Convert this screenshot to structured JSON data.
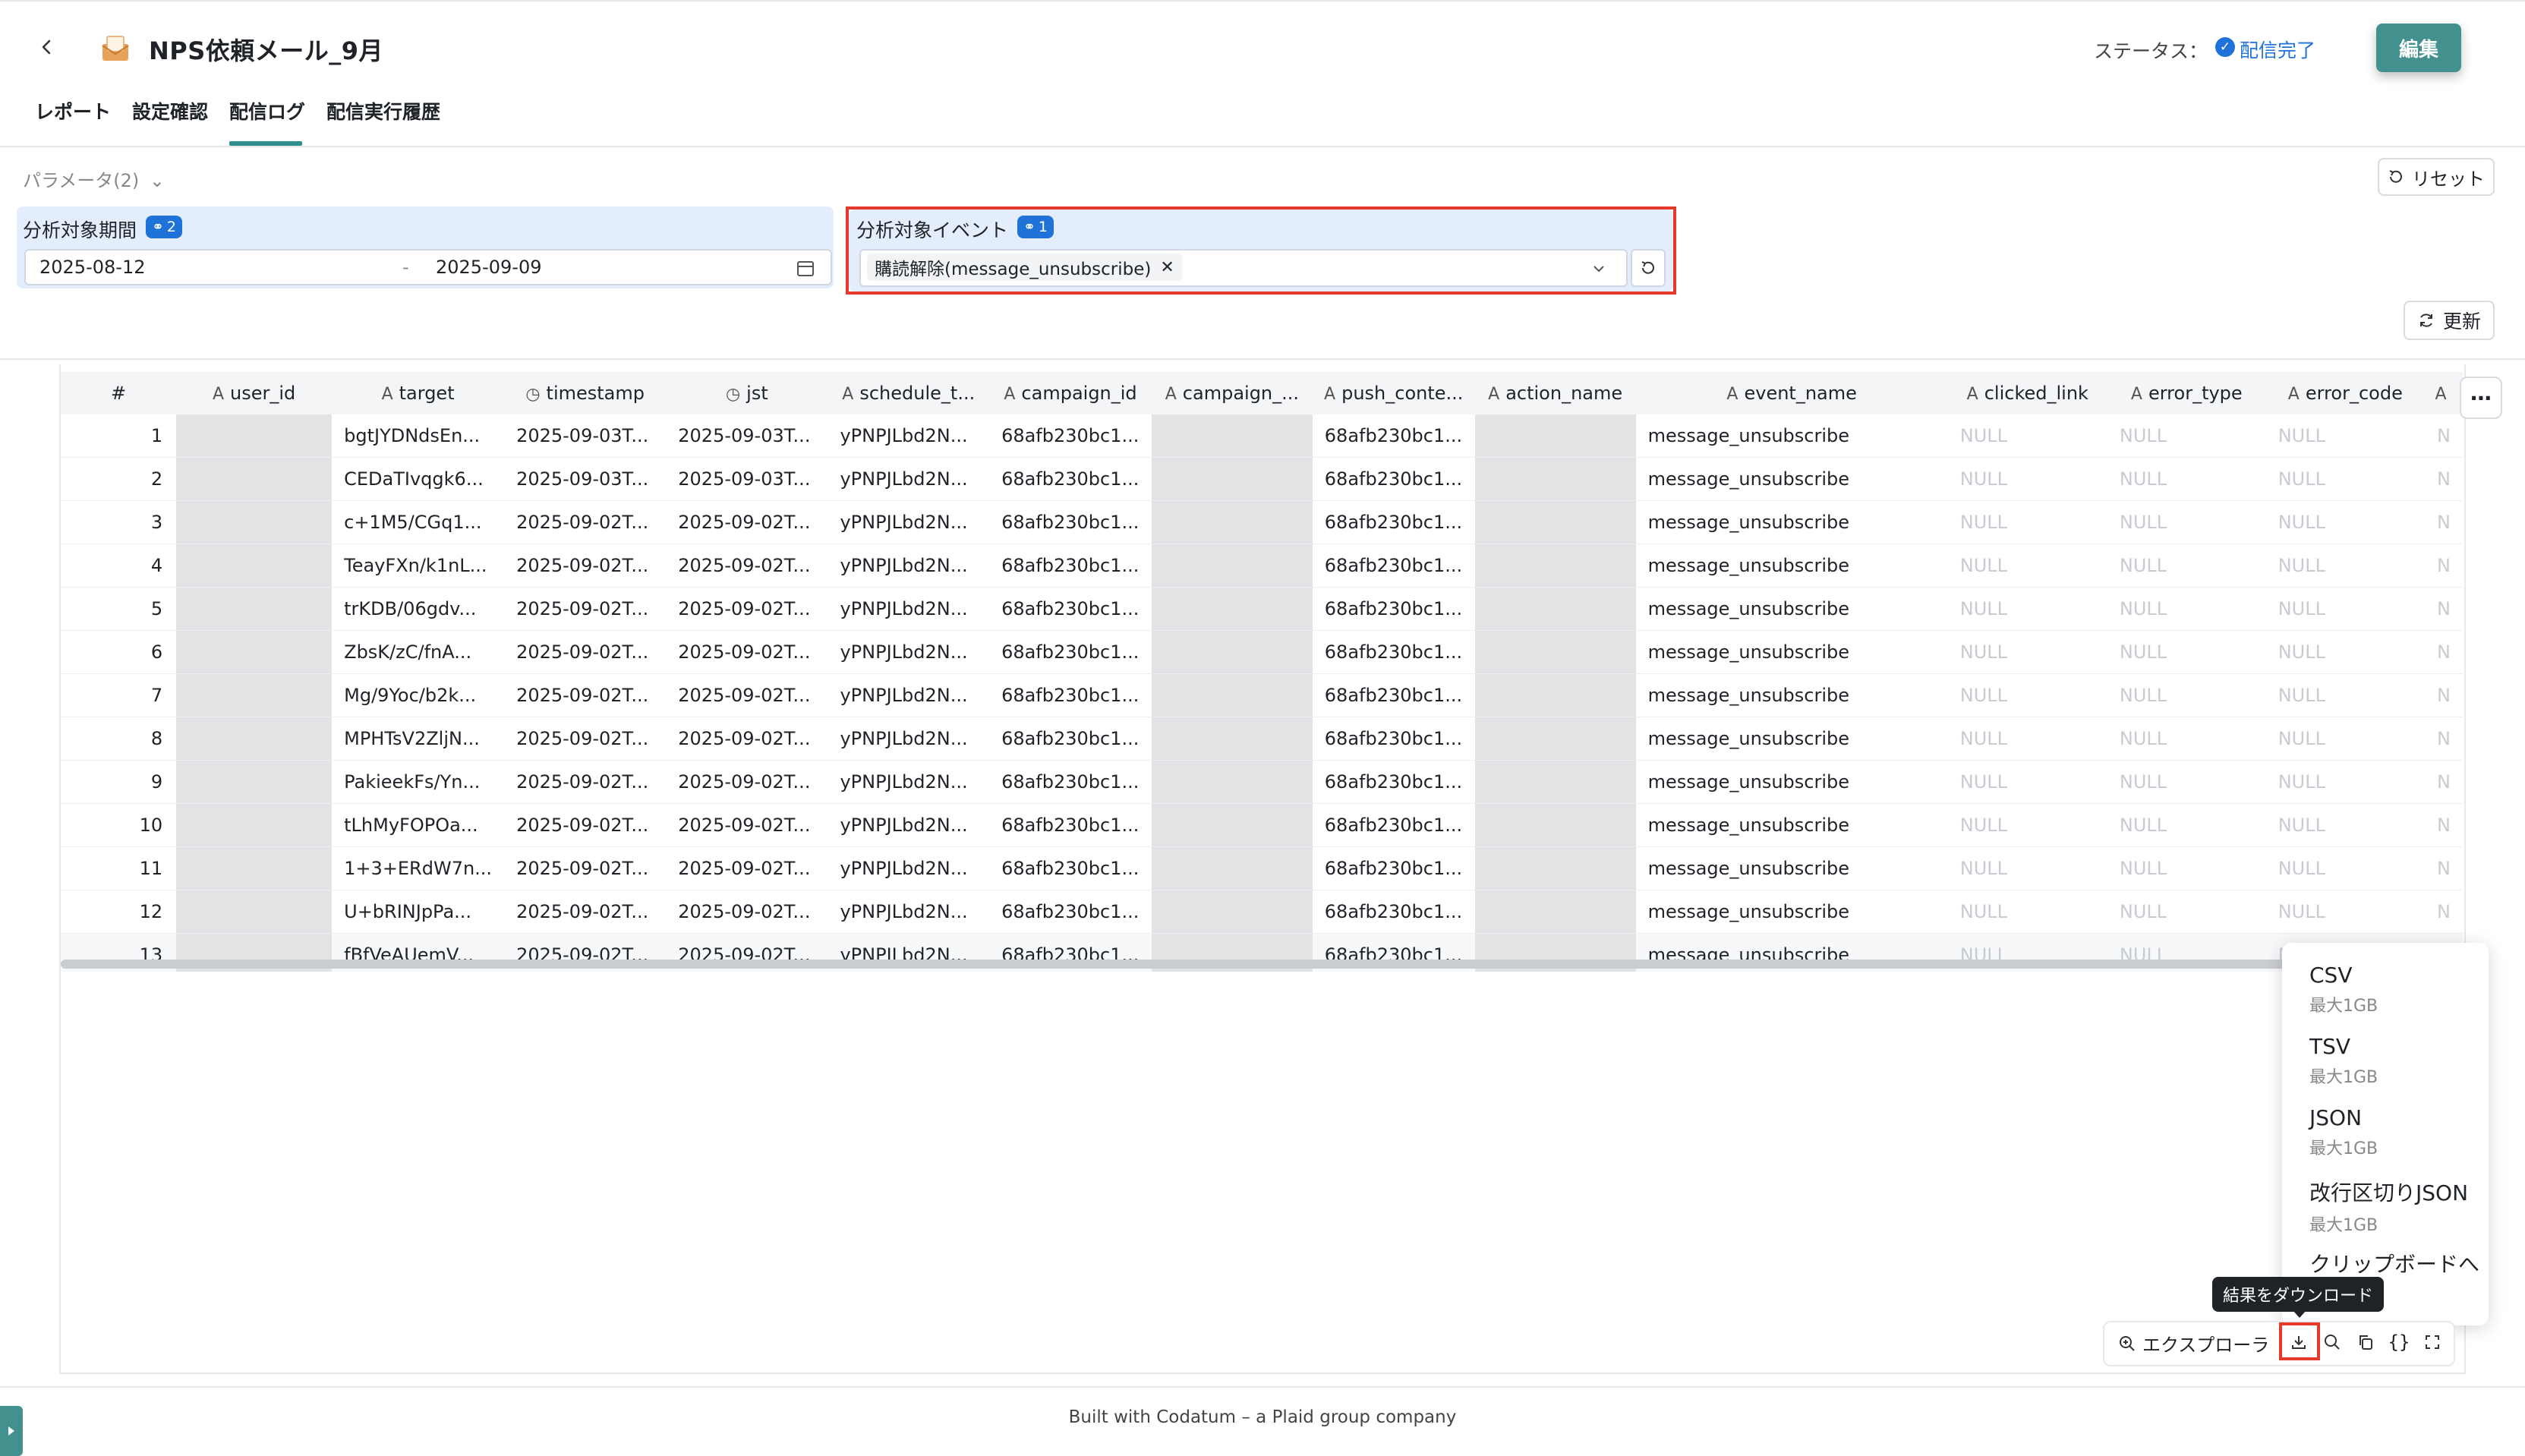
{
  "header": {
    "title": "NPS依頼メール_9月",
    "status_label": "ステータス：",
    "status_value": "配信完了",
    "edit_label": "編集"
  },
  "tabs": [
    {
      "label": "レポート"
    },
    {
      "label": "設定確認"
    },
    {
      "label": "配信ログ",
      "active": true
    },
    {
      "label": "配信実行履歴"
    }
  ],
  "params": {
    "toggle_label": "パラメータ(2)",
    "reset_label": "リセット",
    "refresh_label": "更新",
    "period": {
      "label": "分析対象期間",
      "badge": "2",
      "start": "2025-08-12",
      "separator": "-",
      "end": "2025-09-09"
    },
    "event": {
      "label": "分析対象イベント",
      "badge": "1",
      "chip": "購読解除(message_unsubscribe)"
    }
  },
  "table": {
    "columns": [
      {
        "label": "#",
        "icon": ""
      },
      {
        "label": "user_id",
        "icon": "A"
      },
      {
        "label": "target",
        "icon": "A"
      },
      {
        "label": "timestamp",
        "icon": "clock"
      },
      {
        "label": "jst",
        "icon": "clock"
      },
      {
        "label": "schedule_t...",
        "icon": "A"
      },
      {
        "label": "campaign_id",
        "icon": "A"
      },
      {
        "label": "campaign_...",
        "icon": "A"
      },
      {
        "label": "push_conte...",
        "icon": "A"
      },
      {
        "label": "action_name",
        "icon": "A"
      },
      {
        "label": "event_name",
        "icon": "A"
      },
      {
        "label": "clicked_link",
        "icon": "A"
      },
      {
        "label": "error_type",
        "icon": "A"
      },
      {
        "label": "error_code",
        "icon": "A"
      },
      {
        "label": "",
        "icon": "A"
      }
    ],
    "rows": [
      [
        "1",
        "",
        "bgtJYDNdsEn...",
        "2025-09-03T...",
        "2025-09-03T...",
        "yPNPJLbd2N...",
        "68afb230bc1...",
        "",
        "68afb230bc1...",
        "",
        "message_unsubscribe",
        "NULL",
        "NULL",
        "NULL",
        "N"
      ],
      [
        "2",
        "",
        "CEDaTIvqgk6...",
        "2025-09-03T...",
        "2025-09-03T...",
        "yPNPJLbd2N...",
        "68afb230bc1...",
        "",
        "68afb230bc1...",
        "",
        "message_unsubscribe",
        "NULL",
        "NULL",
        "NULL",
        "N"
      ],
      [
        "3",
        "",
        "c+1M5/CGq1...",
        "2025-09-02T...",
        "2025-09-02T...",
        "yPNPJLbd2N...",
        "68afb230bc1...",
        "",
        "68afb230bc1...",
        "",
        "message_unsubscribe",
        "NULL",
        "NULL",
        "NULL",
        "N"
      ],
      [
        "4",
        "",
        "TeayFXn/k1nL...",
        "2025-09-02T...",
        "2025-09-02T...",
        "yPNPJLbd2N...",
        "68afb230bc1...",
        "",
        "68afb230bc1...",
        "",
        "message_unsubscribe",
        "NULL",
        "NULL",
        "NULL",
        "N"
      ],
      [
        "5",
        "",
        "trKDB/06gdv...",
        "2025-09-02T...",
        "2025-09-02T...",
        "yPNPJLbd2N...",
        "68afb230bc1...",
        "",
        "68afb230bc1...",
        "",
        "message_unsubscribe",
        "NULL",
        "NULL",
        "NULL",
        "N"
      ],
      [
        "6",
        "",
        "ZbsK/zC/fnA...",
        "2025-09-02T...",
        "2025-09-02T...",
        "yPNPJLbd2N...",
        "68afb230bc1...",
        "",
        "68afb230bc1...",
        "",
        "message_unsubscribe",
        "NULL",
        "NULL",
        "NULL",
        "N"
      ],
      [
        "7",
        "",
        "Mg/9Yoc/b2k...",
        "2025-09-02T...",
        "2025-09-02T...",
        "yPNPJLbd2N...",
        "68afb230bc1...",
        "",
        "68afb230bc1...",
        "",
        "message_unsubscribe",
        "NULL",
        "NULL",
        "NULL",
        "N"
      ],
      [
        "8",
        "",
        "MPHTsV2ZljN...",
        "2025-09-02T...",
        "2025-09-02T...",
        "yPNPJLbd2N...",
        "68afb230bc1...",
        "",
        "68afb230bc1...",
        "",
        "message_unsubscribe",
        "NULL",
        "NULL",
        "NULL",
        "N"
      ],
      [
        "9",
        "",
        "PakieekFs/Yn...",
        "2025-09-02T...",
        "2025-09-02T...",
        "yPNPJLbd2N...",
        "68afb230bc1...",
        "",
        "68afb230bc1...",
        "",
        "message_unsubscribe",
        "NULL",
        "NULL",
        "NULL",
        "N"
      ],
      [
        "10",
        "",
        "tLhMyFOPOa...",
        "2025-09-02T...",
        "2025-09-02T...",
        "yPNPJLbd2N...",
        "68afb230bc1...",
        "",
        "68afb230bc1...",
        "",
        "message_unsubscribe",
        "NULL",
        "NULL",
        "NULL",
        "N"
      ],
      [
        "11",
        "",
        "1+3+ERdW7n...",
        "2025-09-02T...",
        "2025-09-02T...",
        "yPNPJLbd2N...",
        "68afb230bc1...",
        "",
        "68afb230bc1...",
        "",
        "message_unsubscribe",
        "NULL",
        "NULL",
        "NULL",
        "N"
      ],
      [
        "12",
        "",
        "U+bRINJpPa...",
        "2025-09-02T...",
        "2025-09-02T...",
        "yPNPJLbd2N...",
        "68afb230bc1...",
        "",
        "68afb230bc1...",
        "",
        "message_unsubscribe",
        "NULL",
        "NULL",
        "NULL",
        "N"
      ],
      [
        "13",
        "",
        "fBfVeAUemV...",
        "2025-09-02T...",
        "2025-09-02T...",
        "yPNPJLbd2N...",
        "68afb230bc1...",
        "",
        "68afb230bc1...",
        "",
        "message_unsubscribe",
        "NULL",
        "NULL",
        "NULL",
        "N"
      ]
    ],
    "masked_columns": [
      1,
      7,
      9
    ]
  },
  "download_menu": [
    {
      "label": "CSV",
      "sub": "最大1GB"
    },
    {
      "label": "TSV",
      "sub": "最大1GB"
    },
    {
      "label": "JSON",
      "sub": "最大1GB"
    },
    {
      "label": "改行区切りJSON",
      "sub": "最大1GB"
    },
    {
      "label": "クリップボードへ",
      "sub": ""
    }
  ],
  "toolbar": {
    "explorer_label": "エクスプローラ",
    "download_tooltip": "結果をダウンロード",
    "icons": [
      "download-icon",
      "search-icon",
      "copy-icon",
      "code-braces-icon",
      "fullscreen-icon"
    ]
  },
  "footer": {
    "text": "Built with Codatum – a Plaid group company"
  },
  "colors": {
    "accent": "#43918f",
    "status_blue": "#1f73d8",
    "highlight_red": "#e5392e",
    "panel_bg": "#e3edfb"
  }
}
